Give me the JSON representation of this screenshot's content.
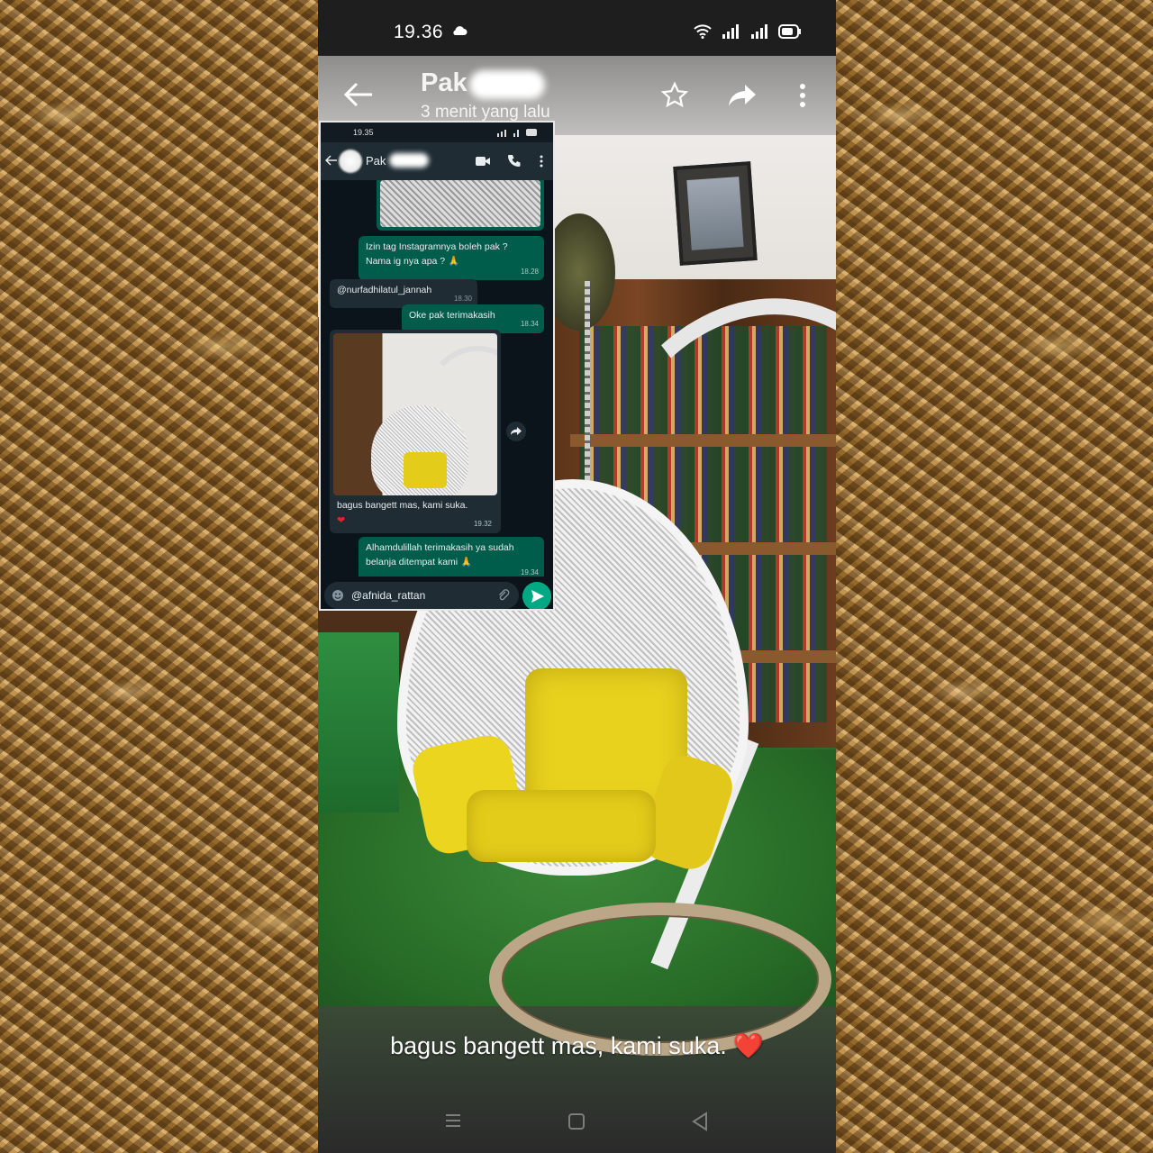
{
  "status_bar": {
    "time": "19.36"
  },
  "story_header": {
    "title": "Pak",
    "subtitle": "3 menit yang lalu"
  },
  "embedded_chat": {
    "status_time": "19.35",
    "contact_name": "Pak",
    "messages": [
      {
        "type": "image",
        "direction": "out"
      },
      {
        "direction": "out",
        "text_line1": "Izin tag Instagramnya boleh pak ?",
        "text_line2": "Nama ig nya apa ? 🙏",
        "time": "18.28"
      },
      {
        "direction": "in",
        "text": "@nurfadhilatul_jannah",
        "time": "18.30"
      },
      {
        "direction": "out",
        "text": "Oke pak terimakasih",
        "time": "18.34"
      },
      {
        "direction": "in",
        "type": "image",
        "caption": "bagus bangett mas, kami suka.",
        "emoji": "❤",
        "time": "19.32"
      },
      {
        "direction": "out",
        "text_line1": "Alhamdulillah terimakasih ya sudah",
        "text_line2": "belanja ditempat kami 🙏",
        "time": "19.34"
      }
    ],
    "input_value": "@afnida_rattan"
  },
  "caption": {
    "text": "bagus bangett mas, kami suka.",
    "emoji": "❤️"
  },
  "colors": {
    "whatsapp_bg": "#0b141a",
    "whatsapp_out": "#005c4b",
    "whatsapp_in": "#1f2c34",
    "send_button": "#00a884",
    "cushion": "#e9d21e",
    "turf": "#2f7a30"
  },
  "icons": [
    "back-arrow-icon",
    "star-icon",
    "forward-icon",
    "more-vert-icon",
    "video-call-icon",
    "phone-icon",
    "send-icon",
    "emoji-icon",
    "attach-icon",
    "wifi-icon",
    "signal-icon",
    "battery-icon",
    "cloud-icon"
  ]
}
